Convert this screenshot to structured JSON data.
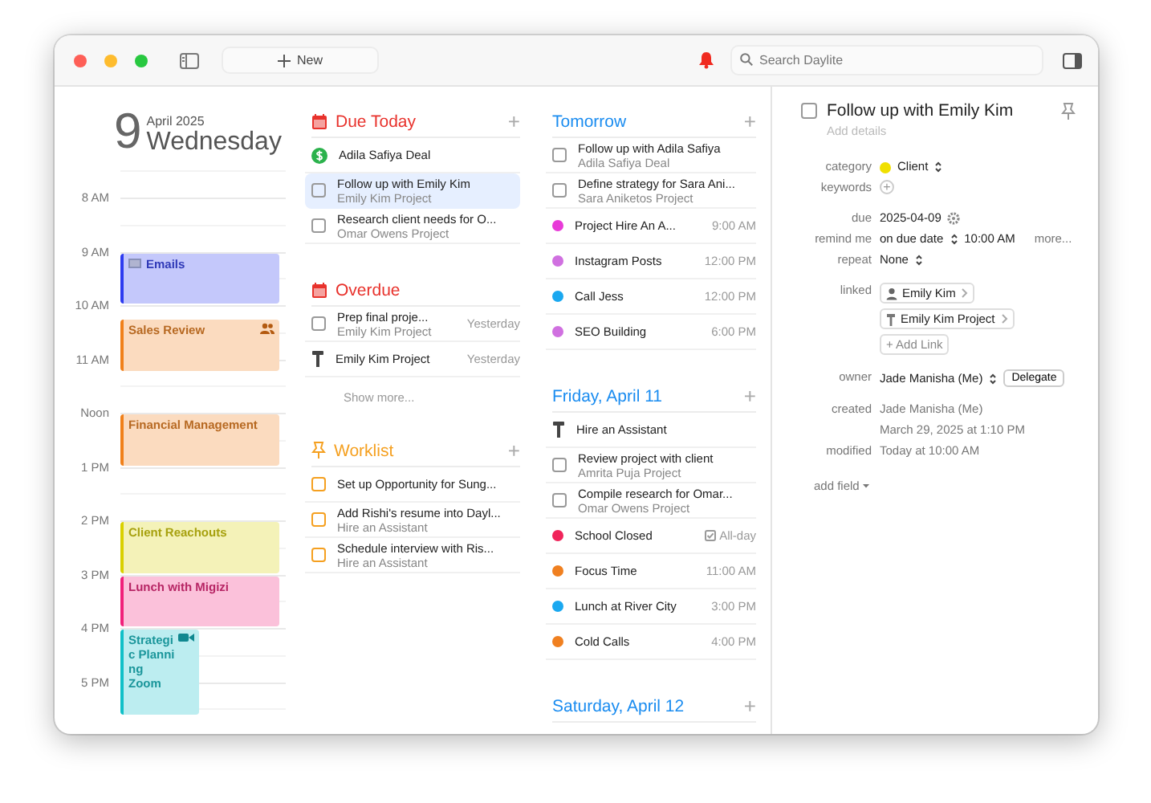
{
  "toolbar": {
    "new_label": "New",
    "search": {
      "placeholder": "Search Daylite"
    },
    "alert": true
  },
  "day": {
    "number": "9",
    "month": "April 2025",
    "weekday": "Wednesday",
    "hours": [
      "8 AM",
      "9 AM",
      "10 AM",
      "11 AM",
      "Noon",
      "1 PM",
      "2 PM",
      "3 PM",
      "4 PM",
      "5 PM"
    ],
    "events": [
      {
        "kind": "email",
        "title": "Emails",
        "color": "#2d3bf0"
      },
      {
        "kind": "meeting",
        "title": "Sales Review",
        "color": "#f0801a"
      },
      {
        "kind": "plain",
        "title": "Financial Management",
        "color": "#f0801a"
      },
      {
        "kind": "plain",
        "title": "Client Reachouts",
        "color": "#d9d000"
      },
      {
        "kind": "plain",
        "title": "Lunch with Migizi",
        "color": "#f0207a"
      },
      {
        "kind": "video",
        "title": "Strategic Planning",
        "location": "Zoom",
        "color": "#10c0c8"
      }
    ]
  },
  "columns": [
    [
      {
        "kind": "due",
        "title": "Due Today",
        "color": "#e8322c",
        "add": "+",
        "items": [
          {
            "kind": "deal",
            "title": "Adila Safiya Deal",
            "selected": false
          },
          {
            "kind": "task",
            "title": "Follow up with Emily Kim",
            "subtitle": "Emily Kim Project",
            "checked": false,
            "selected": true
          },
          {
            "kind": "task",
            "title": "Research client needs for O...",
            "subtitle": "Omar Owens Project",
            "checked": false,
            "selected": false
          }
        ]
      },
      {
        "kind": "due",
        "title": "Overdue",
        "color": "#e8322c",
        "show_more": "Show more...",
        "items": [
          {
            "kind": "task",
            "title": "Prep final proje...",
            "subtitle": "Emily Kim Project",
            "date": "Yesterday",
            "checked": false,
            "selected": false
          },
          {
            "kind": "project",
            "title": "Emily Kim Project",
            "date": "Yesterday",
            "selected": false
          }
        ]
      },
      {
        "kind": "worklist",
        "title": "Worklist",
        "color": "#f5a020",
        "add": "+",
        "items": [
          {
            "kind": "task",
            "title": "Set up Opportunity for Sung...",
            "checked": false,
            "selected": false
          },
          {
            "kind": "task",
            "title": "Add Rishi's resume into Dayl...",
            "subtitle": "Hire an Assistant",
            "checked": false,
            "selected": false
          },
          {
            "kind": "task",
            "title": "Schedule interview with Ris...",
            "subtitle": "Hire an Assistant",
            "checked": false,
            "selected": false
          }
        ]
      }
    ],
    [
      {
        "kind": "day",
        "title": "Tomorrow",
        "color": "#1a8cf0",
        "add": "+",
        "items": [
          {
            "kind": "task",
            "title": "Follow up with Adila Safiya",
            "subtitle": "Adila Safiya Deal",
            "checked": false,
            "selected": false
          },
          {
            "kind": "task",
            "title": "Define strategy for Sara Ani...",
            "subtitle": "Sara Aniketos Project",
            "checked": false,
            "selected": false
          },
          {
            "kind": "event",
            "title": "Project Hire An A...",
            "date": "9:00 AM",
            "color": "#e83ad8",
            "selected": false
          },
          {
            "kind": "event",
            "title": "Instagram Posts",
            "date": "12:00 PM",
            "color": "#d070e0",
            "selected": false
          },
          {
            "kind": "event",
            "title": "Call Jess",
            "date": "12:00 PM",
            "color": "#1aa8f0",
            "selected": false
          },
          {
            "kind": "event",
            "title": "SEO Building",
            "date": "6:00 PM",
            "color": "#d070e0",
            "selected": false
          }
        ]
      },
      {
        "kind": "day",
        "title": "Friday, April 11",
        "color": "#1a8cf0",
        "add": "+",
        "items": [
          {
            "kind": "project",
            "title": "Hire an Assistant",
            "selected": false
          },
          {
            "kind": "task",
            "title": "Review project with client",
            "subtitle": "Amrita Puja Project",
            "checked": false,
            "selected": false
          },
          {
            "kind": "task",
            "title": "Compile research for Omar...",
            "subtitle": "Omar Owens Project",
            "checked": false,
            "selected": false
          },
          {
            "kind": "all_day_event",
            "title": "School Closed",
            "date": "All-day",
            "color": "#f0245a",
            "selected": false
          },
          {
            "kind": "event",
            "title": "Focus Time",
            "date": "11:00 AM",
            "color": "#f08020",
            "selected": false
          },
          {
            "kind": "event",
            "title": "Lunch at River City",
            "date": "3:00 PM",
            "color": "#1aa8f0",
            "selected": false
          },
          {
            "kind": "event",
            "title": "Cold Calls",
            "date": "4:00 PM",
            "color": "#f08020",
            "selected": false
          }
        ]
      },
      {
        "kind": "day",
        "title": "Saturday, April 12",
        "color": "#1a8cf0",
        "add": "+"
      }
    ]
  ],
  "detail": {
    "title": "Follow up with Emily Kim",
    "checked": false,
    "placeholder": "Add details",
    "groups": [
      [
        {
          "kind": "category",
          "label": "category",
          "value": "Client",
          "color": "#f0e000"
        },
        {
          "kind": "add",
          "label": "keywords",
          "button": "+"
        }
      ],
      [
        {
          "kind": "date",
          "label": "due",
          "value": "2025-04-09"
        },
        {
          "kind": "reminder",
          "label": "remind me",
          "value": "on due date",
          "time": "10:00 AM",
          "more": "more..."
        },
        {
          "kind": "popup",
          "label": "repeat",
          "value": "None"
        }
      ],
      [
        {
          "kind": "links",
          "label": "linked",
          "links": [
            {
              "kind": "person",
              "title": "Emily Kim"
            },
            {
              "kind": "project",
              "title": "Emily Kim Project"
            }
          ],
          "add_link": "+ Add Link"
        }
      ],
      [
        {
          "kind": "owner",
          "label": "owner",
          "value": "Jade Manisha (Me)",
          "button": "Delegate"
        }
      ],
      [
        {
          "kind": "text",
          "label": "created",
          "lines": [
            "Jade Manisha (Me)",
            "March 29, 2025 at 1:10 PM"
          ]
        },
        {
          "kind": "text",
          "label": "modified",
          "lines": [
            "Today at 10:00 AM"
          ]
        }
      ]
    ],
    "add_field": "add field"
  }
}
